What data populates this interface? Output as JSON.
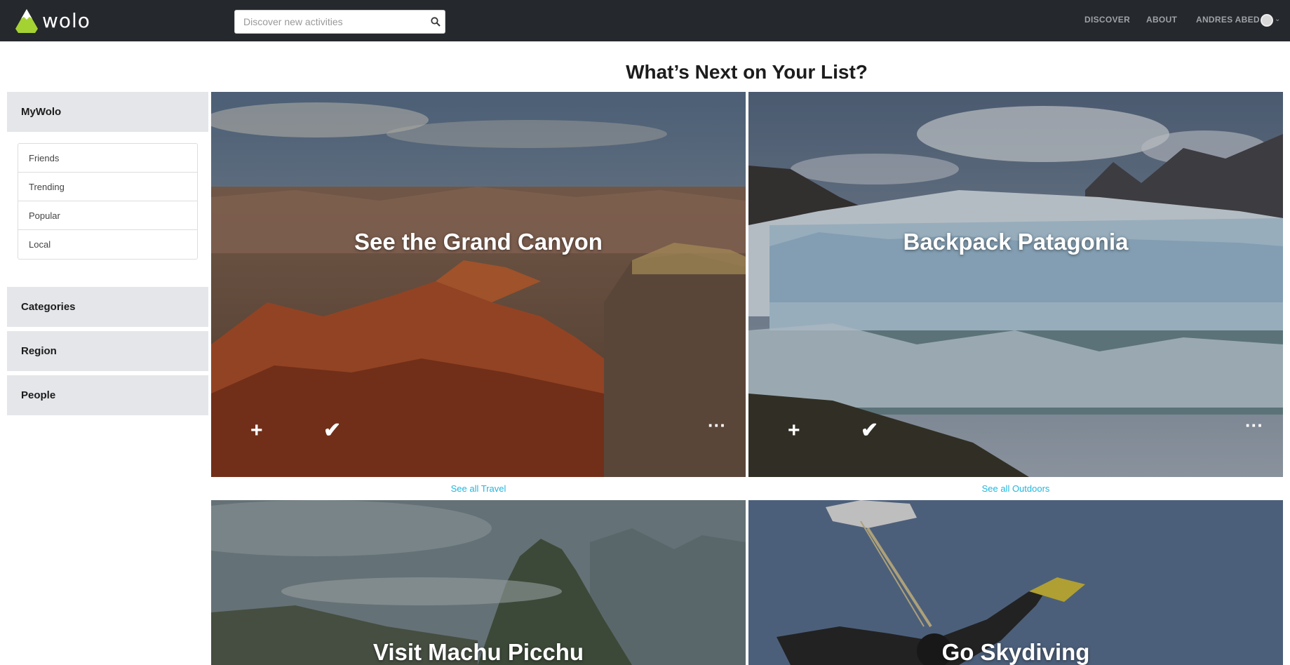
{
  "navbar": {
    "brand": "wolo",
    "search_placeholder": "Discover new activities",
    "links": [
      "DISCOVER",
      "ABOUT",
      "ANDRES ABED"
    ]
  },
  "page_title": "What’s Next on Your List?",
  "sidebar": {
    "mywolo": "MyWolo",
    "items": [
      "Friends",
      "Trending",
      "Popular",
      "Local"
    ],
    "categories": "Categories",
    "region": "Region",
    "people": "People"
  },
  "cards": [
    {
      "title": "See the Grand Canyon",
      "see_all": "See all Travel"
    },
    {
      "title": "Backpack Patagonia",
      "see_all": "See all Outdoors"
    },
    {
      "title": "Visit Machu Picchu"
    },
    {
      "title": "Go Skydiving"
    }
  ],
  "icons": {
    "add": "plus-icon",
    "done": "check-icon",
    "more": "ellipsis-icon"
  },
  "colors": {
    "navbar_bg": "#25282c",
    "brand_green": "#a4d233",
    "link_blue": "#20b7e0",
    "sidebar_bg": "#e4e6e9"
  }
}
